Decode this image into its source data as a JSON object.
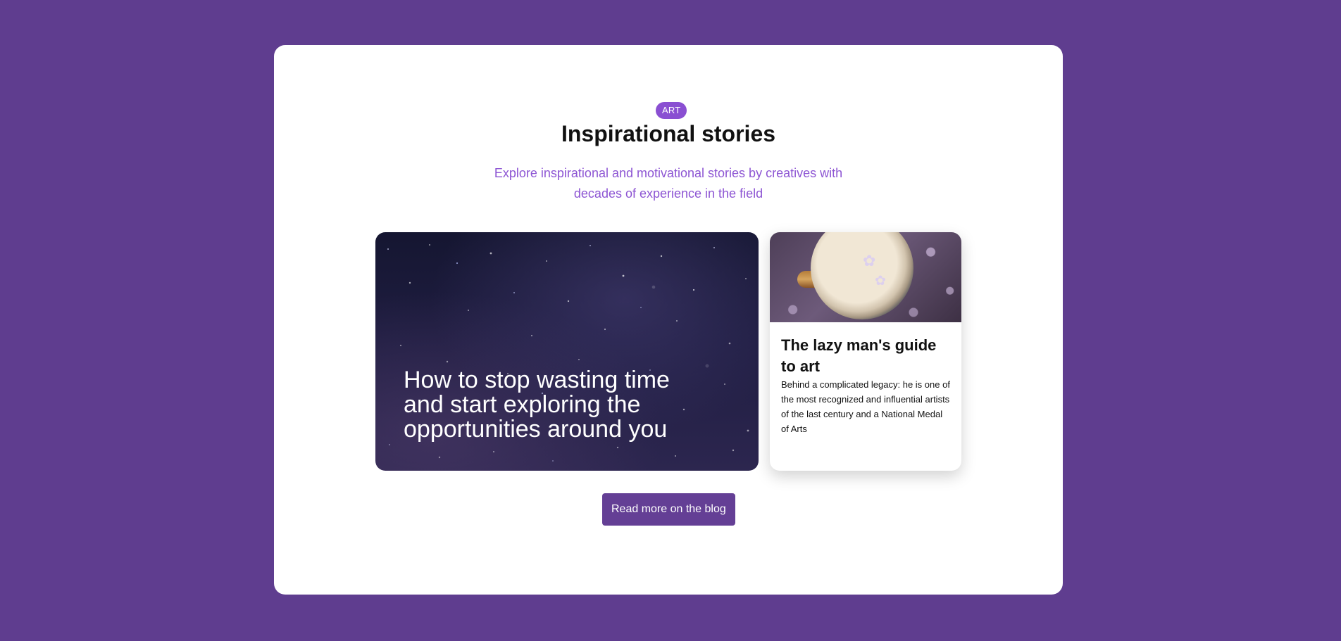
{
  "colors": {
    "background": "#5f3d8f",
    "panel": "#ffffff",
    "accent": "#8a4fd2",
    "button": "#643f95",
    "subtitle": "#8d55d3"
  },
  "section": {
    "badge": "ART",
    "title": "Inspirational stories",
    "subtitle": "Explore inspirational and motivational stories by creatives with decades of experience in the field"
  },
  "featured_card": {
    "title": "How to stop wasting time and start exploring the opportunities around you",
    "image": "night-sky-stars"
  },
  "side_card": {
    "image": "coffee-cup-with-lilac-flowers",
    "title": "The lazy man's guide to art",
    "text": "Behind a complicated legacy: he is one of the most recognized and influential artists of the last century and a National Medal of Arts"
  },
  "actions": {
    "read_more": "Read more on the blog"
  }
}
